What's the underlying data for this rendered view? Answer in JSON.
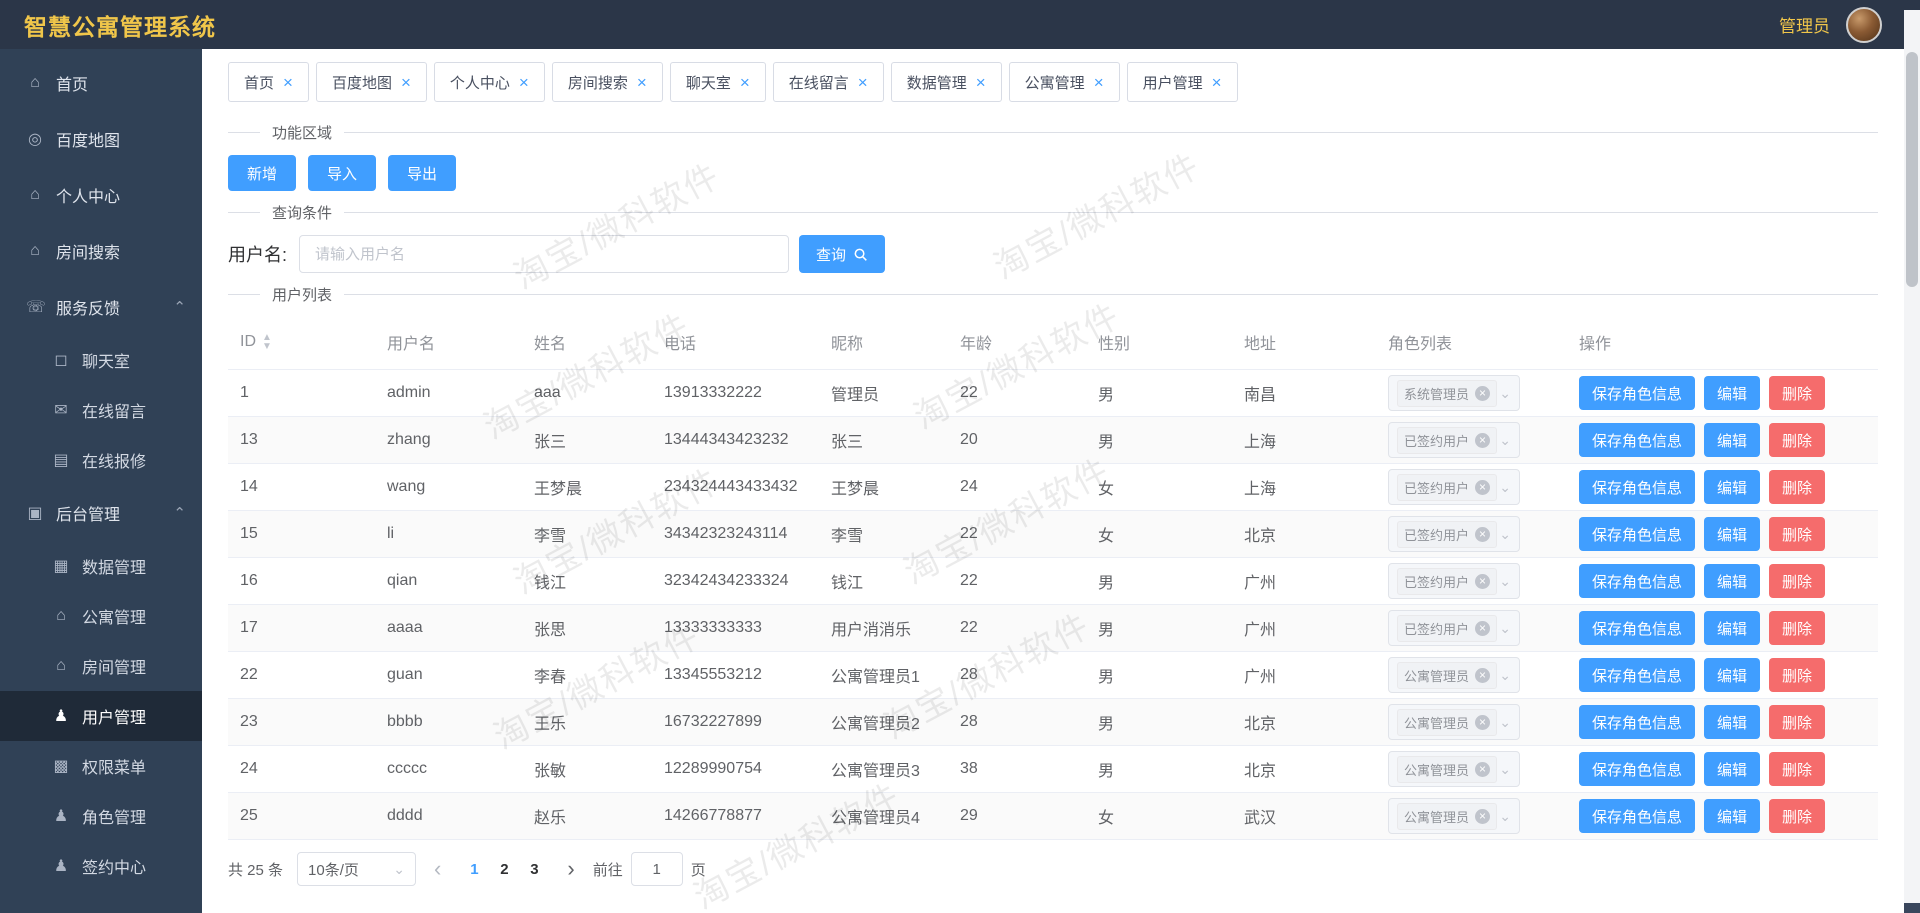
{
  "header": {
    "title": "智慧公寓管理系统",
    "user_label": "管理员"
  },
  "icons": {
    "close": "×",
    "caret_down": "⌄",
    "caret_up": "⌃",
    "sort_asc": "▲",
    "sort_desc": "▼",
    "prev": "‹",
    "next": "›",
    "tag_close": "×"
  },
  "sidebar": {
    "items": [
      {
        "label": "首页",
        "icon": "⌂"
      },
      {
        "label": "百度地图",
        "icon": "◎"
      },
      {
        "label": "个人中心",
        "icon": "⌂"
      },
      {
        "label": "房间搜索",
        "icon": "⌂"
      },
      {
        "label": "服务反馈",
        "icon": "☏"
      },
      {
        "label": "聊天室",
        "icon": "◻"
      },
      {
        "label": "在线留言",
        "icon": "✉"
      },
      {
        "label": "在线报修",
        "icon": "▤"
      },
      {
        "label": "后台管理",
        "icon": "▣"
      },
      {
        "label": "数据管理",
        "icon": "▦"
      },
      {
        "label": "公寓管理",
        "icon": "⌂"
      },
      {
        "label": "房间管理",
        "icon": "⌂"
      },
      {
        "label": "用户管理",
        "icon": "♟"
      },
      {
        "label": "权限菜单",
        "icon": "▩"
      },
      {
        "label": "角色管理",
        "icon": "♟"
      },
      {
        "label": "签约中心",
        "icon": "♟"
      }
    ]
  },
  "tabs": {
    "items": [
      {
        "label": "首页"
      },
      {
        "label": "百度地图"
      },
      {
        "label": "个人中心"
      },
      {
        "label": "房间搜索"
      },
      {
        "label": "聊天室"
      },
      {
        "label": "在线留言"
      },
      {
        "label": "数据管理"
      },
      {
        "label": "公寓管理"
      },
      {
        "label": "用户管理"
      }
    ]
  },
  "sections": {
    "toolbar": "功能区域",
    "query": "查询条件",
    "list": "用户列表"
  },
  "toolbar": {
    "add": "新增",
    "import": "导入",
    "export": "导出"
  },
  "query": {
    "username_label": "用户名:",
    "placeholder": "请输入用户名",
    "search": "查询"
  },
  "table": {
    "columns": [
      "ID",
      "用户名",
      "姓名",
      "电话",
      "昵称",
      "年龄",
      "性别",
      "地址",
      "角色列表",
      "操作"
    ],
    "actions": {
      "save": "保存角色信息",
      "edit": "编辑",
      "delete": "删除"
    },
    "rows": [
      {
        "id": "1",
        "username": "admin",
        "name": "aaa",
        "phone": "13913332222",
        "nickname": "管理员",
        "age": "22",
        "gender": "男",
        "address": "南昌",
        "role": "系统管理员"
      },
      {
        "id": "13",
        "username": "zhang",
        "name": "张三",
        "phone": "13444343423232",
        "nickname": "张三",
        "age": "20",
        "gender": "男",
        "address": "上海",
        "role": "已签约用户"
      },
      {
        "id": "14",
        "username": "wang",
        "name": "王梦晨",
        "phone": "234324443433432",
        "nickname": "王梦晨",
        "age": "24",
        "gender": "女",
        "address": "上海",
        "role": "已签约用户"
      },
      {
        "id": "15",
        "username": "li",
        "name": "李雪",
        "phone": "34342323243114",
        "nickname": "李雪",
        "age": "22",
        "gender": "女",
        "address": "北京",
        "role": "已签约用户"
      },
      {
        "id": "16",
        "username": "qian",
        "name": "钱江",
        "phone": "32342434233324",
        "nickname": "钱江",
        "age": "22",
        "gender": "男",
        "address": "广州",
        "role": "已签约用户"
      },
      {
        "id": "17",
        "username": "aaaa",
        "name": "张思",
        "phone": "13333333333",
        "nickname": "用户消消乐",
        "age": "22",
        "gender": "男",
        "address": "广州",
        "role": "已签约用户"
      },
      {
        "id": "22",
        "username": "guan",
        "name": "李春",
        "phone": "13345553212",
        "nickname": "公寓管理员1",
        "age": "28",
        "gender": "男",
        "address": "广州",
        "role": "公寓管理员"
      },
      {
        "id": "23",
        "username": "bbbb",
        "name": "王乐",
        "phone": "16732227899",
        "nickname": "公寓管理员2",
        "age": "28",
        "gender": "男",
        "address": "北京",
        "role": "公寓管理员"
      },
      {
        "id": "24",
        "username": "ccccc",
        "name": "张敏",
        "phone": "12289990754",
        "nickname": "公寓管理员3",
        "age": "38",
        "gender": "男",
        "address": "北京",
        "role": "公寓管理员"
      },
      {
        "id": "25",
        "username": "dddd",
        "name": "赵乐",
        "phone": "14266778877",
        "nickname": "公寓管理员4",
        "age": "29",
        "gender": "女",
        "address": "武汉",
        "role": "公寓管理员"
      }
    ]
  },
  "pagination": {
    "total": "共 25 条",
    "page_size": "10条/页",
    "pages": [
      "1",
      "2",
      "3"
    ],
    "current_page": "1",
    "goto_label": "前往",
    "goto_value": "1",
    "unit_label": "页"
  },
  "watermark": {
    "text": "淘宝/微科软件"
  }
}
